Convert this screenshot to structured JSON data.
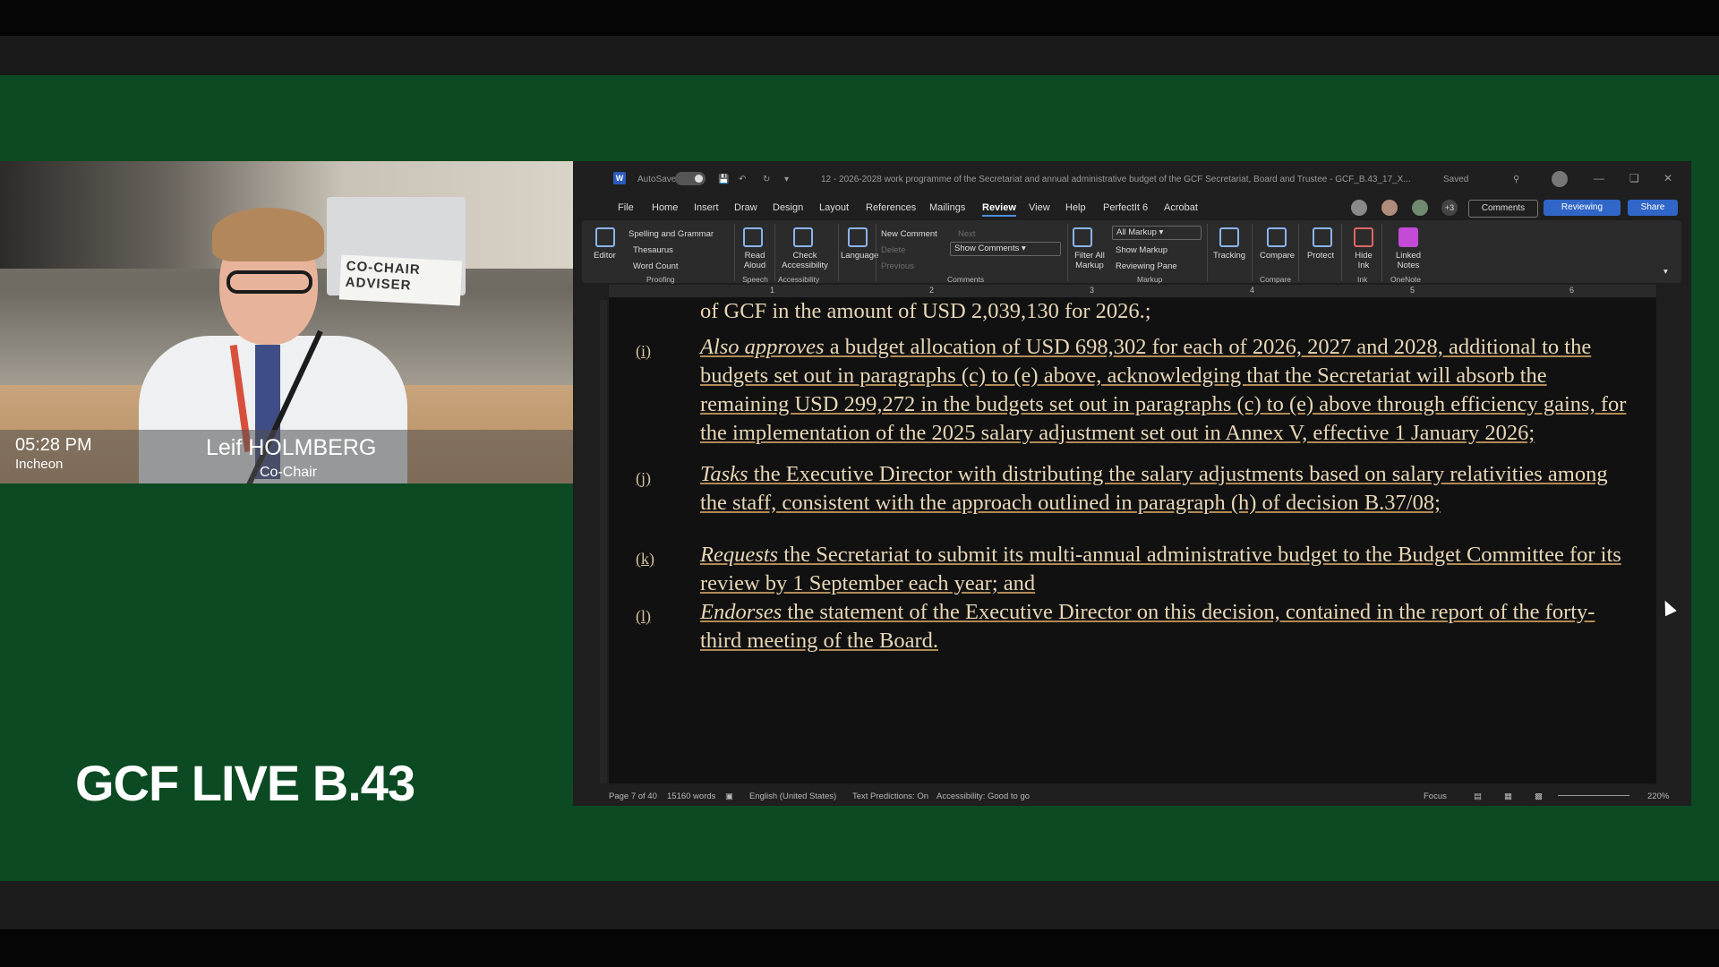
{
  "camera": {
    "time": "05:28 PM",
    "city": "Incheon",
    "speaker_name": "Leif HOLMBERG",
    "speaker_role": "Co-Chair",
    "nameplate": "CO-CHAIR ADVISER"
  },
  "brand": {
    "title": "GCF LIVE B.43"
  },
  "word": {
    "titlebar": {
      "autosave": "AutoSave",
      "toggle_state": "On",
      "doc_title": "12 - 2026-2028 work programme of the Secretariat and annual administrative budget of the GCF Secretariat, Board and Trustee - GCF_B.43_17_X...",
      "saved": "Saved"
    },
    "menu": [
      "File",
      "Home",
      "Insert",
      "Draw",
      "Design",
      "Layout",
      "References",
      "Mailings",
      "Review",
      "View",
      "Help",
      "PerfectIt 6",
      "Acrobat"
    ],
    "menu_active": "Review",
    "header_buttons": {
      "comments": "Comments",
      "reviewing": "Reviewing",
      "share": "Share",
      "avatars_more": "+3"
    },
    "ribbon": {
      "editor": "Editor",
      "spelling": "Spelling and Grammar",
      "thesaurus": "Thesaurus",
      "word_count": "Word Count",
      "group_proofing": "Proofing",
      "read_aloud": "Read Aloud",
      "group_speech": "Speech",
      "check_accessibility": "Check Accessibility",
      "group_accessibility": "Accessibility",
      "language": "Language",
      "new_comment": "New Comment",
      "next": "Next",
      "delete": "Delete",
      "previous": "Previous",
      "show_comments": "Show Comments",
      "group_comments": "Comments",
      "filter_all_markup": "Filter All Markup",
      "markup_select": "All Markup",
      "show_markup": "Show Markup",
      "reviewing_pane": "Reviewing Pane",
      "group_markup": "Markup",
      "tracking": "Tracking",
      "compare": "Compare",
      "group_compare": "Compare",
      "protect": "Protect",
      "hide_ink": "Hide Ink",
      "group_ink": "Ink",
      "linked_notes": "Linked Notes",
      "group_onenote": "OneNote"
    },
    "ruler": [
      "1",
      "2",
      "3",
      "4",
      "5",
      "6"
    ],
    "document": {
      "first_line": "of GCF in the amount of USD 2,039,130 for 2026.;",
      "paragraphs": [
        {
          "label": "(i)",
          "lead": "Also approves",
          "text": " a budget allocation of USD 698,302 for each of 2026, 2027 and 2028, additional to the budgets set out in paragraphs (c) to (e) above, acknowledging that the Secretariat will absorb the remaining USD 299,272 in the budgets set out in paragraphs (c) to (e) above through efficiency gains, for the implementation of the 2025 salary adjustment set out in Annex V, effective 1 January 2026;"
        },
        {
          "label": "(j)",
          "lead": "Tasks",
          "text": " the Executive Director with distributing the salary adjustments based on salary relativities among the staff, consistent with the approach outlined in paragraph (h) of decision B.37/08;"
        },
        {
          "label": "(k)",
          "lead": "Requests",
          "text": " the Secretariat to submit its multi-annual administrative budget to the Budget Committee for its review by 1 September each year; and"
        },
        {
          "label": "(l)",
          "lead": "Endorses",
          "text": " the statement of the Executive Director on this decision, contained in the report of the forty-third meeting of the Board."
        }
      ]
    },
    "status": {
      "page": "Page 7 of 40",
      "words": "15160 words",
      "language": "English (United States)",
      "predictions": "Text Predictions: On",
      "accessibility": "Accessibility: Good to go",
      "focus": "Focus",
      "zoom": "220%"
    }
  },
  "colors": {
    "stage": "#0b4a22",
    "doc_text": "#e8d7b6",
    "accent": "#2f66c8"
  }
}
